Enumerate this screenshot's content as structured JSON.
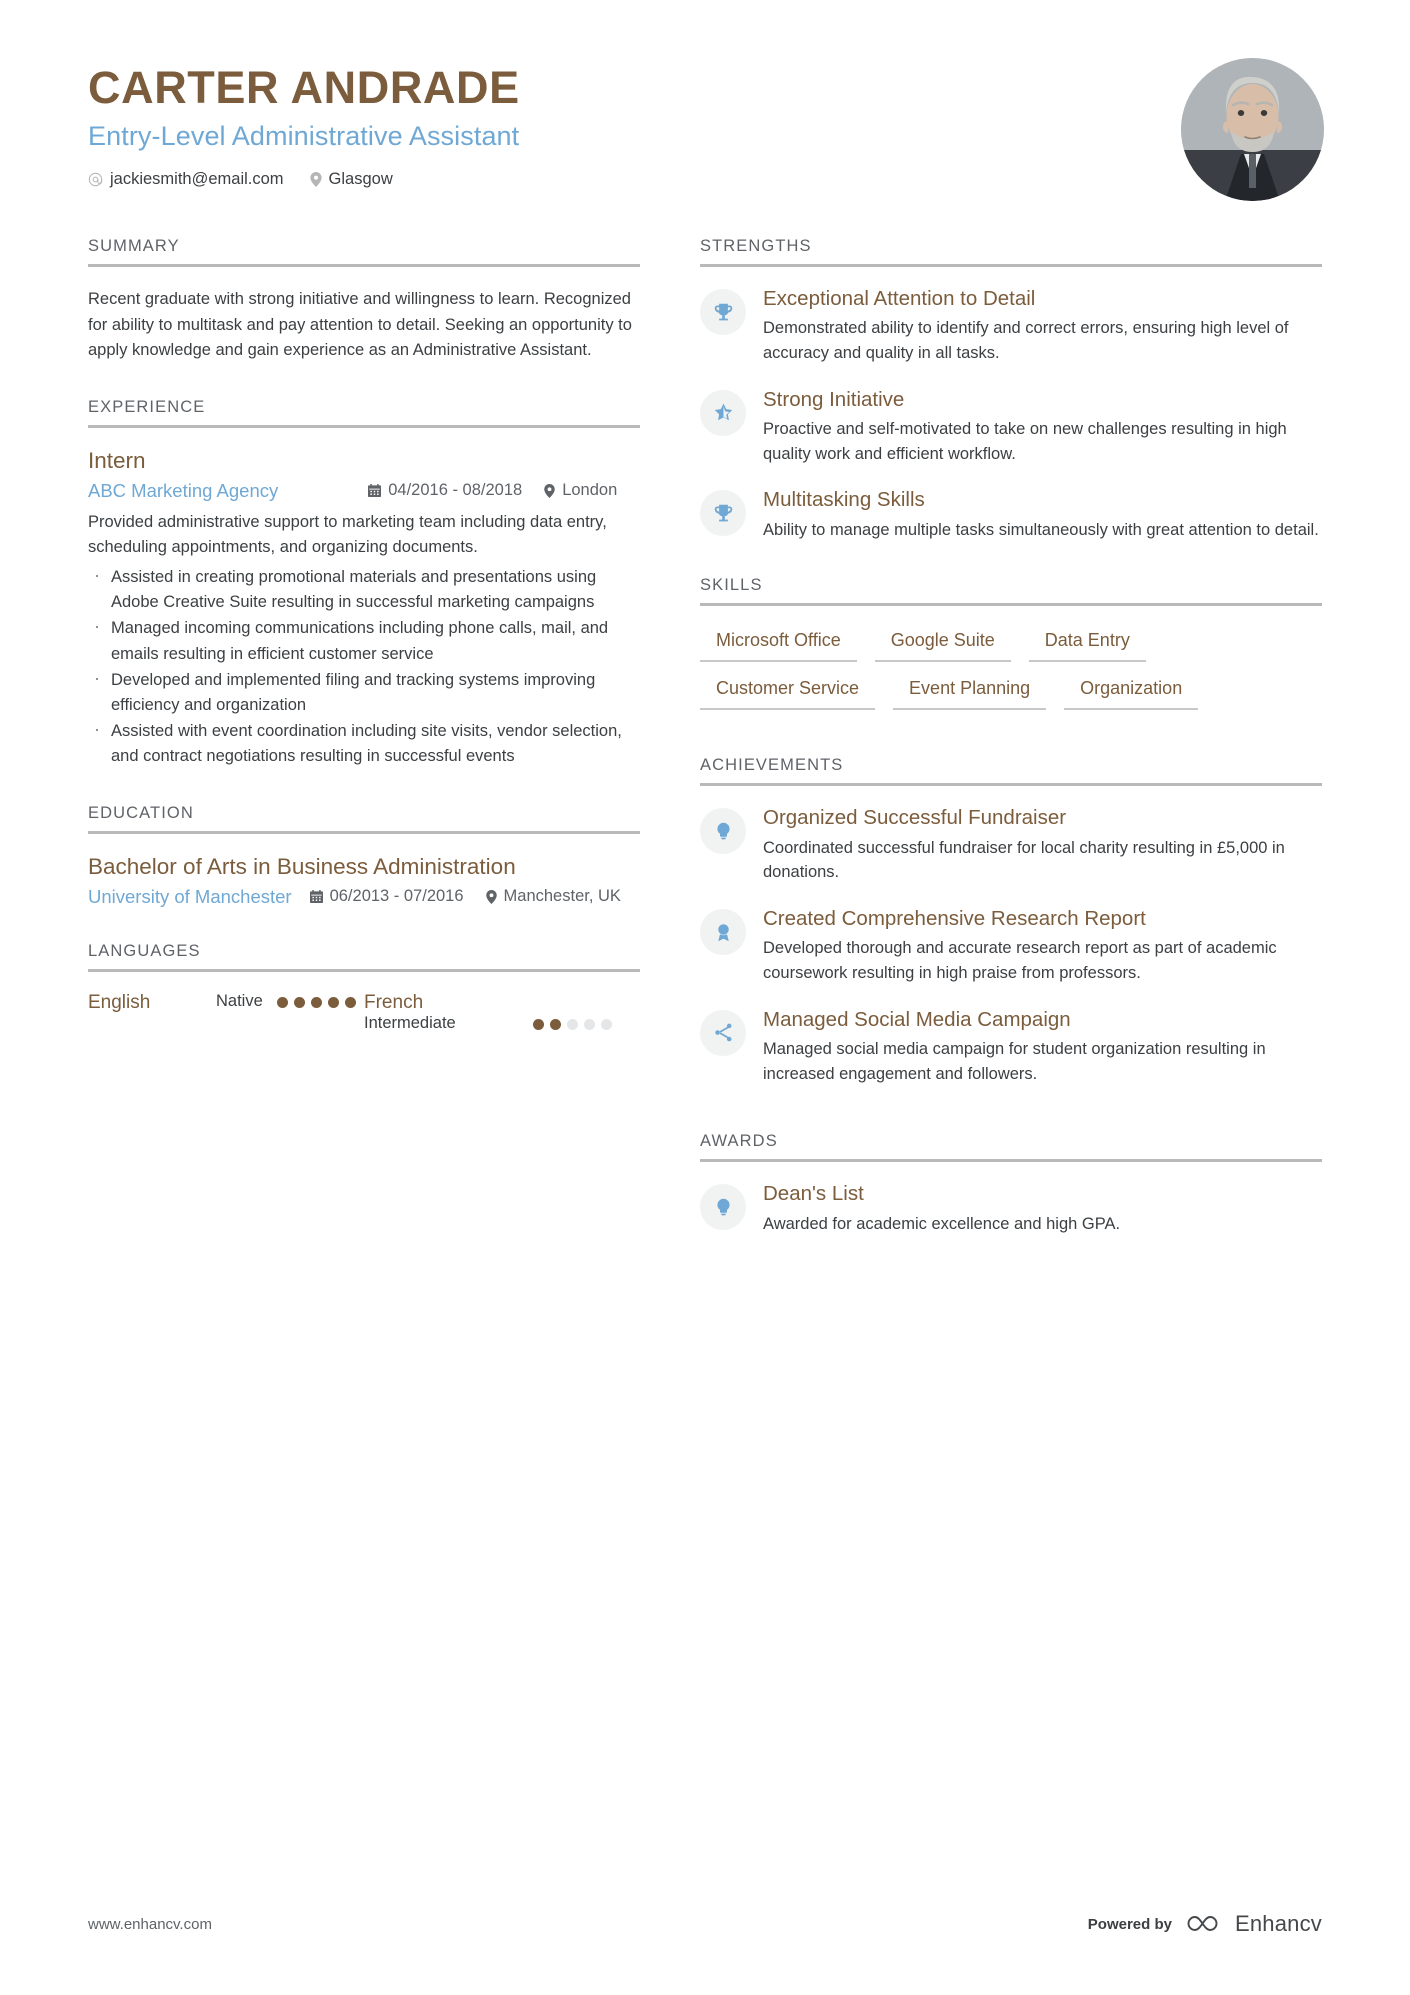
{
  "header": {
    "name": "CARTER ANDRADE",
    "job_title": "Entry-Level Administrative Assistant",
    "email": "jackiesmith@email.com",
    "location": "Glasgow",
    "accent_brown": "#7b5c3c",
    "accent_blue": "#6fa8d4"
  },
  "summary": {
    "heading": "SUMMARY",
    "text": "Recent graduate with strong initiative and willingness to learn. Recognized for ability to multitask and pay attention to detail. Seeking an opportunity to apply knowledge and gain experience as an Administrative Assistant."
  },
  "experience": {
    "heading": "EXPERIENCE",
    "entries": [
      {
        "title": "Intern",
        "organization": "ABC Marketing Agency",
        "dates": "04/2016 - 08/2018",
        "location": "London",
        "description": "Provided administrative support to marketing team including data entry, scheduling appointments, and organizing documents.",
        "bullets": [
          "Assisted in creating promotional materials and presentations using Adobe Creative Suite resulting in successful marketing campaigns",
          "Managed incoming communications including phone calls, mail, and emails resulting in efficient customer service",
          "Developed and implemented filing and tracking systems improving efficiency and organization",
          "Assisted with event coordination including site visits, vendor selection, and contract negotiations resulting in successful events"
        ]
      }
    ]
  },
  "education": {
    "heading": "EDUCATION",
    "entries": [
      {
        "degree": "Bachelor of Arts in Business Administration",
        "school": "University of Manchester",
        "dates": "06/2013 - 07/2016",
        "location": "Manchester, UK"
      }
    ]
  },
  "languages": {
    "heading": "LANGUAGES",
    "items": [
      {
        "name": "English",
        "level": "Native",
        "rating": 5,
        "max": 5
      },
      {
        "name": "French",
        "level": "Intermediate",
        "rating": 2,
        "max": 5
      }
    ]
  },
  "strengths": {
    "heading": "STRENGTHS",
    "items": [
      {
        "icon": "trophy-icon",
        "title": "Exceptional Attention to Detail",
        "description": "Demonstrated ability to identify and correct errors, ensuring high level of accuracy and quality in all tasks."
      },
      {
        "icon": "star-half-icon",
        "title": "Strong Initiative",
        "description": "Proactive and self-motivated to take on new challenges resulting in high quality work and efficient workflow."
      },
      {
        "icon": "trophy-icon",
        "title": "Multitasking Skills",
        "description": "Ability to manage multiple tasks simultaneously with great attention to detail."
      }
    ]
  },
  "skills": {
    "heading": "SKILLS",
    "items": [
      "Microsoft Office",
      "Google Suite",
      "Data Entry",
      "Customer Service",
      "Event Planning",
      "Organization"
    ]
  },
  "achievements": {
    "heading": "ACHIEVEMENTS",
    "items": [
      {
        "icon": "lightbulb-icon",
        "title": "Organized Successful Fundraiser",
        "description": "Coordinated successful fundraiser for local charity resulting in £5,000 in donations."
      },
      {
        "icon": "award-badge-icon",
        "title": "Created Comprehensive Research Report",
        "description": "Developed thorough and accurate research report as part of academic coursework resulting in high praise from professors."
      },
      {
        "icon": "share-nodes-icon",
        "title": "Managed Social Media Campaign",
        "description": "Managed social media campaign for student organization resulting in increased engagement and followers."
      }
    ]
  },
  "awards": {
    "heading": "AWARDS",
    "items": [
      {
        "icon": "lightbulb-icon",
        "title": "Dean's List",
        "description": "Awarded for academic excellence and high GPA."
      }
    ]
  },
  "footer": {
    "url": "www.enhancv.com",
    "powered_by": "Powered by",
    "brand": "Enhancv"
  }
}
